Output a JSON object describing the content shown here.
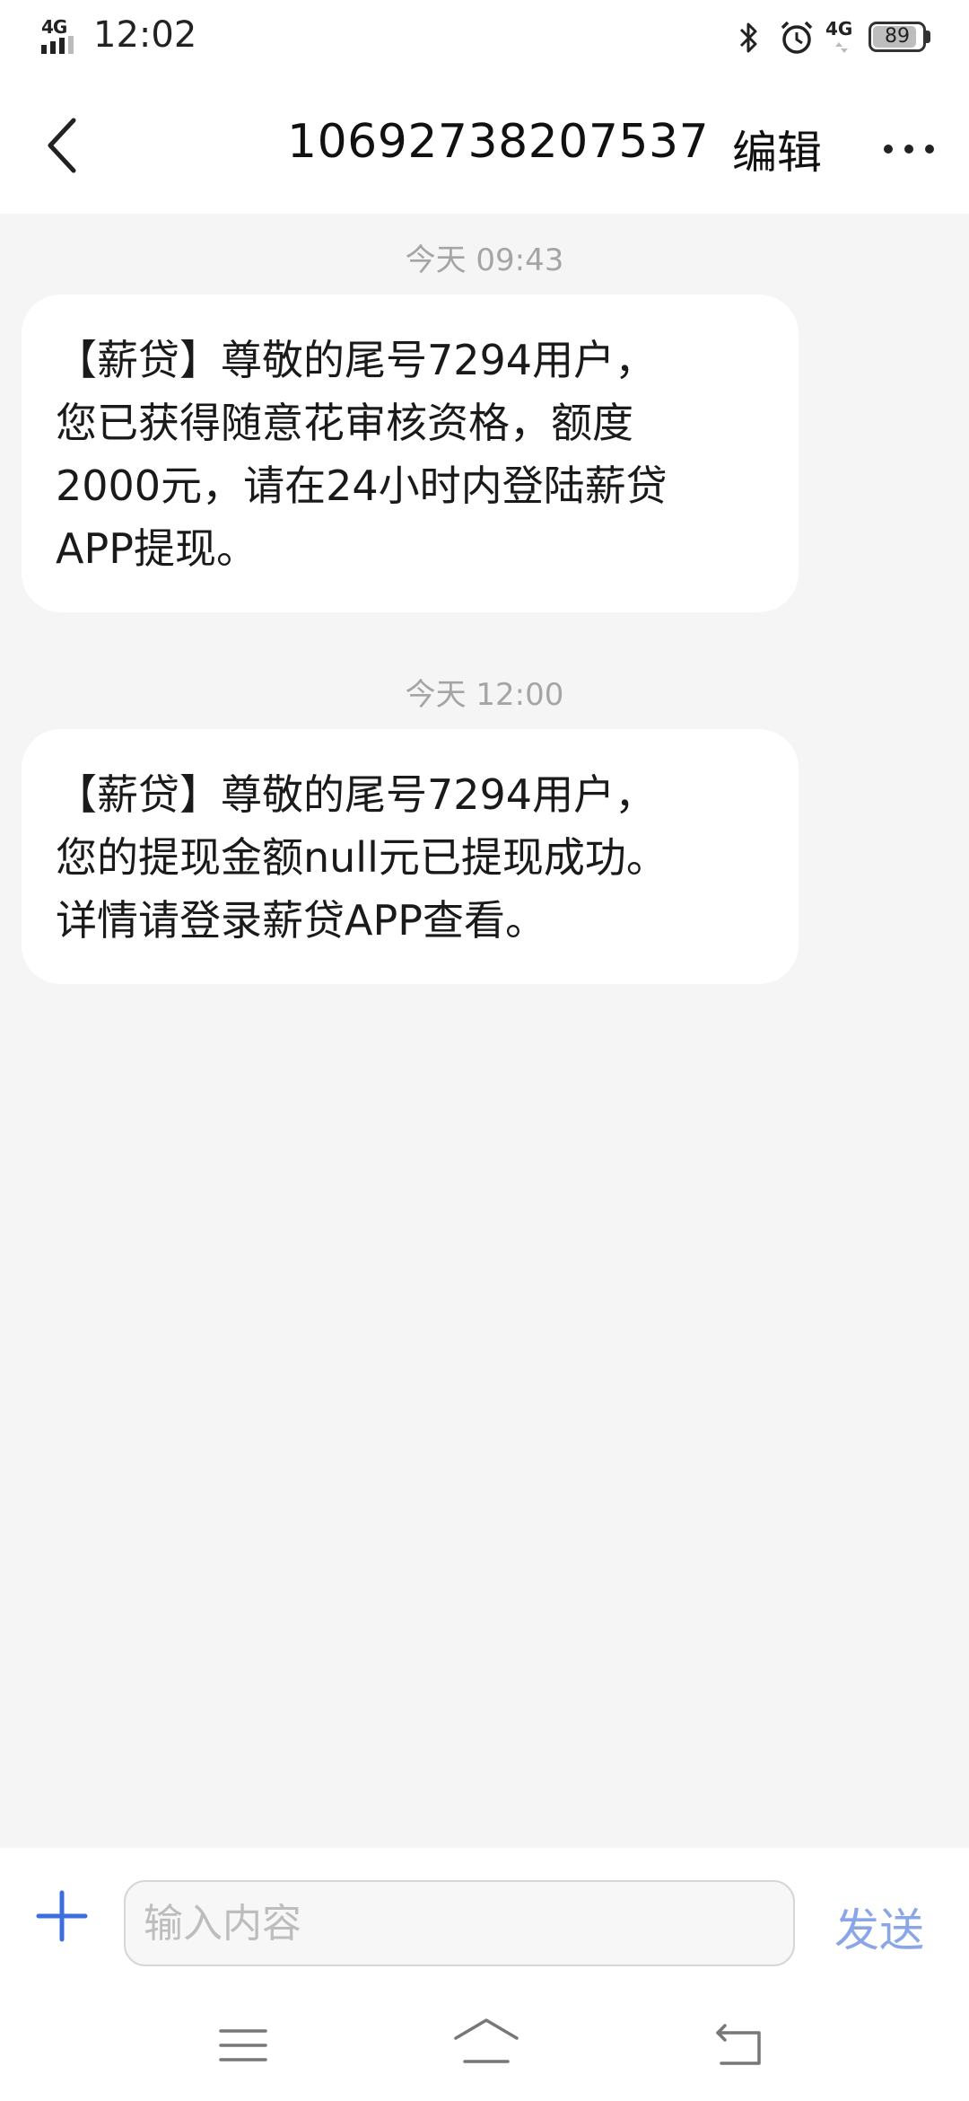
{
  "status_bar": {
    "network_label": "4G",
    "time": "12:02",
    "network_right": "4G",
    "battery_level": "89"
  },
  "header": {
    "title": "10692738207537",
    "edit_label": "编辑"
  },
  "messages": [
    {
      "timestamp": "今天 09:43",
      "lines": [
        "【薪贷】尊敬的尾号7294用户，",
        "您已获得随意花审核资格，额度",
        "2000元，请在24小时内登陆薪贷",
        "APP提现。"
      ]
    },
    {
      "timestamp": "今天 12:00",
      "lines": [
        "【薪贷】尊敬的尾号7294用户，",
        "您的提现金额null元已提现成功。",
        "详情请登录薪贷APP查看。"
      ]
    }
  ],
  "input_bar": {
    "placeholder": "输入内容",
    "send_label": "发送"
  },
  "icons": {
    "back": "chevron-left-icon",
    "more": "more-dots-icon",
    "add": "plus-icon",
    "nav_menu": "menu-icon",
    "nav_home": "home-icon",
    "nav_back": "back-arrow-icon"
  },
  "colors": {
    "accent": "#3b6fe0",
    "send_text": "#8aa6e8",
    "timestamp": "#a5a5a5",
    "background": "#f5f5f5"
  }
}
